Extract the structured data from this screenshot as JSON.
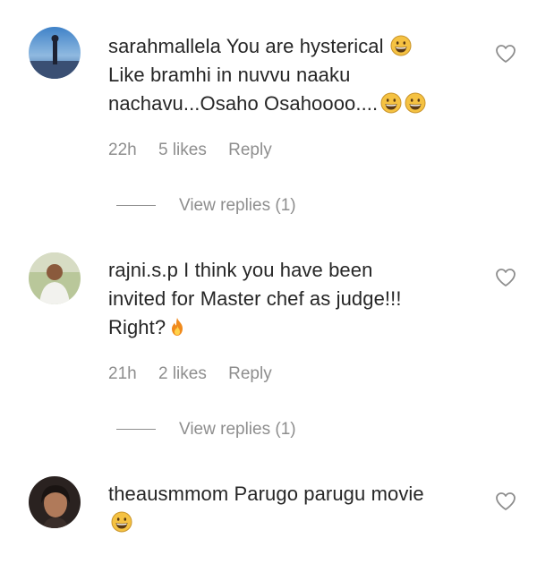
{
  "comments": [
    {
      "username": "sarahmallela",
      "lines": [
        "You are hysterical",
        "Like bramhi in nuvvu naaku",
        "nachavu...Osaho Osahoooo...."
      ],
      "time": "22h",
      "likes": "5 likes",
      "reply_label": "Reply",
      "view_replies": "View replies (1)"
    },
    {
      "username": "rajni.s.p",
      "lines": [
        "I think you have been",
        "invited for Master chef as judge!!!",
        "Right?"
      ],
      "time": "21h",
      "likes": "2 likes",
      "reply_label": "Reply",
      "view_replies": "View replies (1)"
    },
    {
      "username": "theausmmom",
      "lines": [
        "Parugo parugu movie"
      ],
      "time": "",
      "likes": "",
      "reply_label": "",
      "view_replies": ""
    }
  ],
  "icons": {
    "emoji": "grinning-face-icon",
    "fire": "fire-icon",
    "like": "heart-outline-icon"
  },
  "colors": {
    "text": "#262626",
    "secondary": "#8e8e8e"
  }
}
